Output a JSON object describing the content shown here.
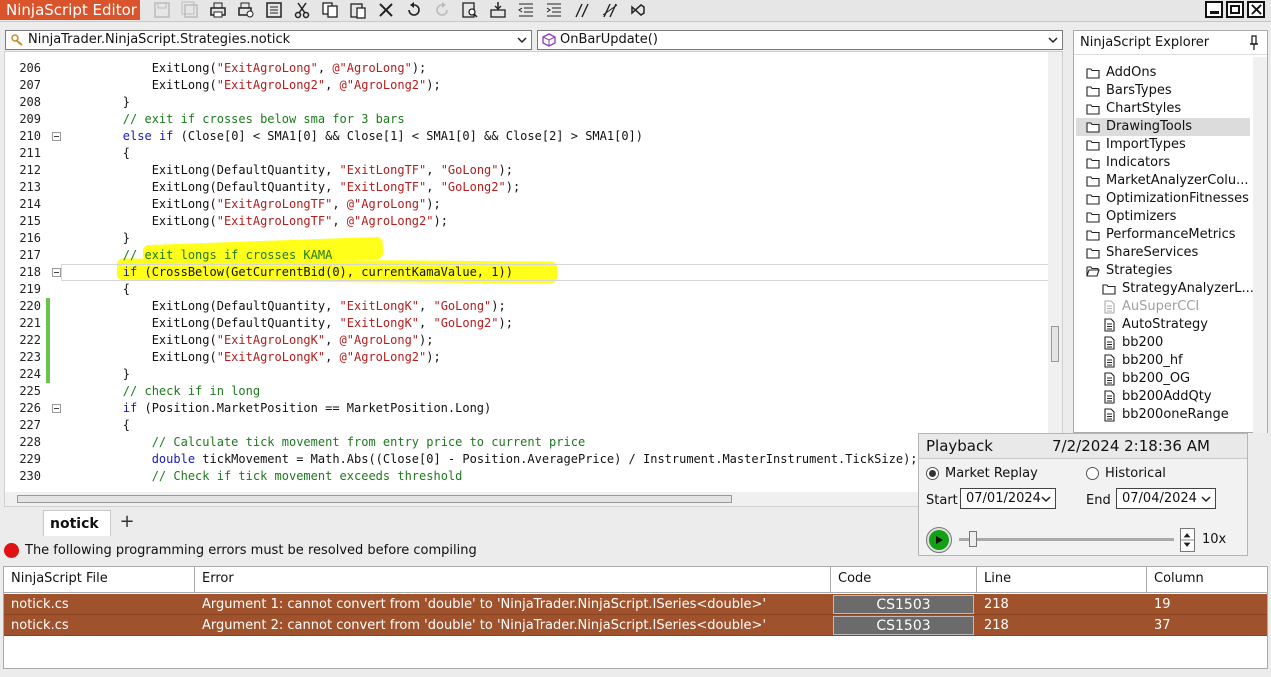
{
  "window": {
    "title": "NinjaScript Editor"
  },
  "toolbar": {
    "icons": [
      "save-icon",
      "save-all-icon",
      "print-icon",
      "print-preview-icon",
      "properties-icon",
      "cut-icon",
      "copy-icon",
      "paste-icon",
      "delete-icon",
      "undo-icon",
      "redo-icon",
      "find-icon",
      "insert-code-icon",
      "outdent-icon",
      "indent-icon",
      "comment-icon",
      "uncomment-icon",
      "visual-studio-icon"
    ]
  },
  "editor": {
    "class_combo": "NinjaTrader.NinjaScript.Strategies.notick",
    "method_combo": "OnBarUpdate()",
    "lines": [
      {
        "num": "206",
        "text": "            ExitLong(\"ExitAgroLong\", @\"AgroLong\");"
      },
      {
        "num": "207",
        "text": "            ExitLong(\"ExitAgroLong2\", @\"AgroLong2\");"
      },
      {
        "num": "208",
        "text": "        }"
      },
      {
        "num": "209",
        "text": "        // exit if crosses below sma for 3 bars"
      },
      {
        "num": "210",
        "text": "        else if (Close[0] < SMA1[0] && Close[1] < SMA1[0] && Close[2] > SMA1[0])"
      },
      {
        "num": "211",
        "text": "        {"
      },
      {
        "num": "212",
        "text": "            ExitLong(DefaultQuantity, \"ExitLongTF\", \"GoLong\");"
      },
      {
        "num": "213",
        "text": "            ExitLong(DefaultQuantity, \"ExitLongTF\", \"GoLong2\");"
      },
      {
        "num": "214",
        "text": "            ExitLong(\"ExitAgroLongTF\", @\"AgroLong\");"
      },
      {
        "num": "215",
        "text": "            ExitLong(\"ExitAgroLongTF\", @\"AgroLong2\");"
      },
      {
        "num": "216",
        "text": "        }"
      },
      {
        "num": "217",
        "text": "        // exit longs if crosses KAMA"
      },
      {
        "num": "218",
        "text": "        if (CrossBelow(GetCurrentBid(0), currentKamaValue, 1))"
      },
      {
        "num": "219",
        "text": "        {"
      },
      {
        "num": "220",
        "text": "            ExitLong(DefaultQuantity, \"ExitLongK\", \"GoLong\");"
      },
      {
        "num": "221",
        "text": "            ExitLong(DefaultQuantity, \"ExitLongK\", \"GoLong2\");"
      },
      {
        "num": "222",
        "text": "            ExitLong(\"ExitAgroLongK\", @\"AgroLong\");"
      },
      {
        "num": "223",
        "text": "            ExitLong(\"ExitAgroLongK\", @\"AgroLong2\");"
      },
      {
        "num": "224",
        "text": "        }"
      },
      {
        "num": "225",
        "text": "        // check if in long"
      },
      {
        "num": "226",
        "text": "        if (Position.MarketPosition == MarketPosition.Long)"
      },
      {
        "num": "227",
        "text": "        {"
      },
      {
        "num": "228",
        "text": "            // Calculate tick movement from entry price to current price"
      },
      {
        "num": "229",
        "text": "            double tickMovement = Math.Abs((Close[0] - Position.AveragePrice) / Instrument.MasterInstrument.TickSize);"
      },
      {
        "num": "230",
        "text": "            // Check if tick movement exceeds threshold"
      }
    ]
  },
  "tabs": {
    "active": "notick",
    "add": "+"
  },
  "errors": {
    "message": "The following programming errors must be resolved before compiling",
    "columns": [
      "NinjaScript File",
      "Error",
      "Code",
      "Line",
      "Column"
    ],
    "rows": [
      {
        "file": "notick.cs",
        "error": "Argument 1: cannot convert from 'double' to 'NinjaTrader.NinjaScript.ISeries<double>'",
        "code": "CS1503",
        "line": "218",
        "column": "19"
      },
      {
        "file": "notick.cs",
        "error": "Argument 2: cannot convert from 'double' to 'NinjaTrader.NinjaScript.ISeries<double>'",
        "code": "CS1503",
        "line": "218",
        "column": "37"
      }
    ]
  },
  "explorer": {
    "title": "NinjaScript Explorer",
    "folders": [
      "AddOns",
      "BarsTypes",
      "ChartStyles",
      "DrawingTools",
      "ImportTypes",
      "Indicators",
      "MarketAnalyzerColu...",
      "OptimizationFitnesses",
      "Optimizers",
      "PerformanceMetrics",
      "ShareServices",
      "Strategies"
    ],
    "strategy_children": [
      "StrategyAnalyzerL...",
      "AuSuperCCI",
      "AutoStrategy",
      "bb200",
      "bb200_hf",
      "bb200_OG",
      "bb200AddQty",
      "bb200oneRange"
    ],
    "selected": "DrawingTools"
  },
  "playback": {
    "title": "Playback",
    "datetime": "7/2/2024 2:18:36 AM",
    "mode_market_replay": "Market Replay",
    "mode_historical": "Historical",
    "start_label": "Start",
    "start_date": "07/01/2024",
    "end_label": "End",
    "end_date": "07/04/2024",
    "speed": "10x"
  }
}
